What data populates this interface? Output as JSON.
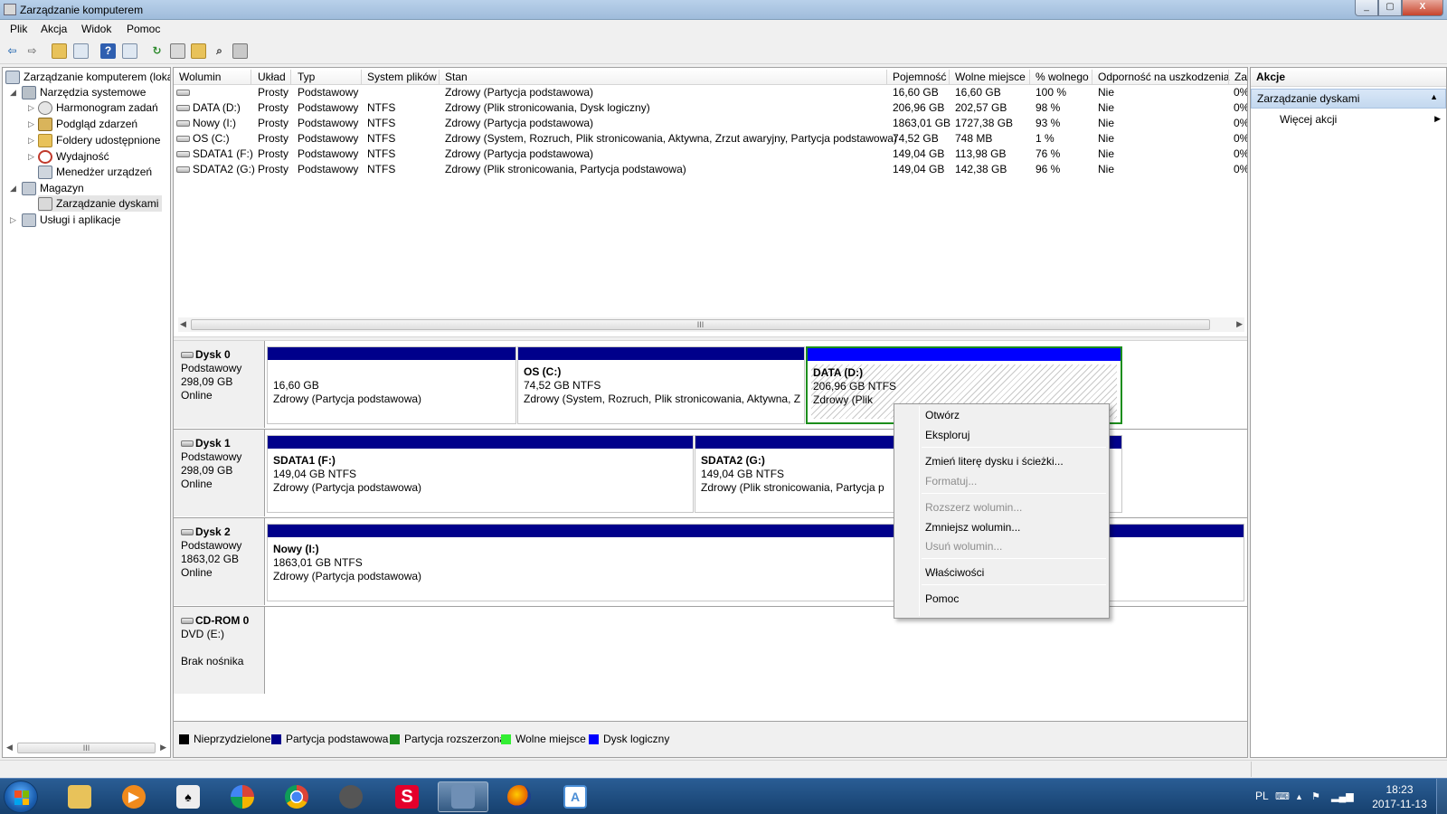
{
  "window": {
    "title": "Zarządzanie komputerem",
    "min": "_",
    "max": "▢",
    "close": "X"
  },
  "menu": [
    "Plik",
    "Akcja",
    "Widok",
    "Pomoc"
  ],
  "tree": {
    "root": "Zarządzanie komputerem (loka",
    "tools": "Narzędzia systemowe",
    "task_scheduler": "Harmonogram zadań",
    "event_viewer": "Podgląd zdarzeń",
    "shared_folders": "Foldery udostępnione",
    "performance": "Wydajność",
    "device_manager": "Menedżer urządzeń",
    "storage": "Magazyn",
    "disk_management": "Zarządzanie dyskami",
    "services": "Usługi i aplikacje",
    "scroll_grip": "III"
  },
  "volume_table": {
    "headers": {
      "volume": "Wolumin",
      "layout": "Układ",
      "type": "Typ",
      "fs": "System plików",
      "status": "Stan",
      "capacity": "Pojemność",
      "free": "Wolne miejsce",
      "pct_free": "% wolnego",
      "fault": "Odporność na uszkodzenia",
      "overhead": "Za"
    },
    "rows": [
      {
        "volume": "",
        "layout": "Prosty",
        "type": "Podstawowy",
        "fs": "",
        "status": "Zdrowy (Partycja podstawowa)",
        "capacity": "16,60 GB",
        "free": "16,60 GB",
        "pct_free": "100 %",
        "fault": "Nie",
        "overhead": "0%"
      },
      {
        "volume": "DATA (D:)",
        "layout": "Prosty",
        "type": "Podstawowy",
        "fs": "NTFS",
        "status": "Zdrowy (Plik stronicowania, Dysk logiczny)",
        "capacity": "206,96 GB",
        "free": "202,57 GB",
        "pct_free": "98 %",
        "fault": "Nie",
        "overhead": "0%"
      },
      {
        "volume": "Nowy (I:)",
        "layout": "Prosty",
        "type": "Podstawowy",
        "fs": "NTFS",
        "status": "Zdrowy (Partycja podstawowa)",
        "capacity": "1863,01 GB",
        "free": "1727,38 GB",
        "pct_free": "93 %",
        "fault": "Nie",
        "overhead": "0%"
      },
      {
        "volume": "OS (C:)",
        "layout": "Prosty",
        "type": "Podstawowy",
        "fs": "NTFS",
        "status": "Zdrowy (System, Rozruch, Plik stronicowania, Aktywna, Zrzut awaryjny, Partycja podstawowa)",
        "capacity": "74,52 GB",
        "free": "748 MB",
        "pct_free": "1 %",
        "fault": "Nie",
        "overhead": "0%"
      },
      {
        "volume": "SDATA1 (F:)",
        "layout": "Prosty",
        "type": "Podstawowy",
        "fs": "NTFS",
        "status": "Zdrowy (Partycja podstawowa)",
        "capacity": "149,04 GB",
        "free": "113,98 GB",
        "pct_free": "76 %",
        "fault": "Nie",
        "overhead": "0%"
      },
      {
        "volume": "SDATA2 (G:)",
        "layout": "Prosty",
        "type": "Podstawowy",
        "fs": "NTFS",
        "status": "Zdrowy (Plik stronicowania, Partycja podstawowa)",
        "capacity": "149,04 GB",
        "free": "142,38 GB",
        "pct_free": "96 %",
        "fault": "Nie",
        "overhead": "0%"
      }
    ],
    "scroll_grip": "III"
  },
  "disks": [
    {
      "name": "Dysk 0",
      "kind": "Podstawowy",
      "size": "298,09 GB",
      "state": "Online",
      "partitions": [
        {
          "name": "",
          "size": "16,60 GB",
          "status": "Zdrowy (Partycja podstawowa)"
        },
        {
          "name": "OS  (C:)",
          "size": "74,52 GB NTFS",
          "status": "Zdrowy (System, Rozruch, Plik stronicowania, Aktywna, Zrz"
        },
        {
          "name": "DATA  (D:)",
          "size": "206,96 GB NTFS",
          "status": "Zdrowy (Plik"
        }
      ]
    },
    {
      "name": "Dysk 1",
      "kind": "Podstawowy",
      "size": "298,09 GB",
      "state": "Online",
      "partitions": [
        {
          "name": "SDATA1  (F:)",
          "size": "149,04 GB NTFS",
          "status": "Zdrowy (Partycja podstawowa)"
        },
        {
          "name": "SDATA2  (G:)",
          "size": "149,04 GB NTFS",
          "status": "Zdrowy (Plik stronicowania, Partycja p"
        }
      ]
    },
    {
      "name": "Dysk 2",
      "kind": "Podstawowy",
      "size": "1863,02 GB",
      "state": "Online",
      "partitions": [
        {
          "name": "Nowy  (I:)",
          "size": "1863,01 GB NTFS",
          "status": "Zdrowy (Partycja podstawowa)"
        }
      ]
    },
    {
      "name": "CD-ROM 0",
      "kind": "DVD (E:)",
      "size": "",
      "state": "Brak nośnika",
      "partitions": []
    }
  ],
  "legend": [
    {
      "label": "Nieprzydzielone",
      "color": "#000000"
    },
    {
      "label": "Partycja podstawowa",
      "color": "#00008b"
    },
    {
      "label": "Partycja rozszerzona",
      "color": "#1c8e1c"
    },
    {
      "label": "Wolne miejsce",
      "color": "#33ee33"
    },
    {
      "label": "Dysk logiczny",
      "color": "#0000ff"
    }
  ],
  "actions": {
    "title": "Akcje",
    "section": "Zarządzanie dyskami",
    "more": "Więcej akcji"
  },
  "context_menu": {
    "open": "Otwórz",
    "explore": "Eksploruj",
    "change_letter": "Zmień literę dysku i ścieżki...",
    "format": "Formatuj...",
    "extend": "Rozszerz wolumin...",
    "shrink": "Zmniejsz wolumin...",
    "delete": "Usuń wolumin...",
    "properties": "Właściwości",
    "help": "Pomoc"
  },
  "taskbar": {
    "apps": [
      {
        "name": "explorer-icon",
        "color": "#e8c25a"
      },
      {
        "name": "media-player-icon",
        "color": "#f08a1c"
      },
      {
        "name": "solitaire-icon",
        "color": "#eeeeee"
      },
      {
        "name": "picasa-icon",
        "color": "#7dc242"
      },
      {
        "name": "chrome-icon",
        "color": "#db4437"
      },
      {
        "name": "gimp-icon",
        "color": "#555555"
      },
      {
        "name": "s-app-icon",
        "color": "#e4002b",
        "glyph": "S"
      },
      {
        "name": "computer-management-icon",
        "color": "#6f8fb5"
      },
      {
        "name": "firefox-icon",
        "color": "#e66000"
      },
      {
        "name": "wordpad-icon",
        "color": "#4a8ed6"
      }
    ],
    "lang": "PL",
    "time": "18:23",
    "date": "2017-11-13"
  }
}
